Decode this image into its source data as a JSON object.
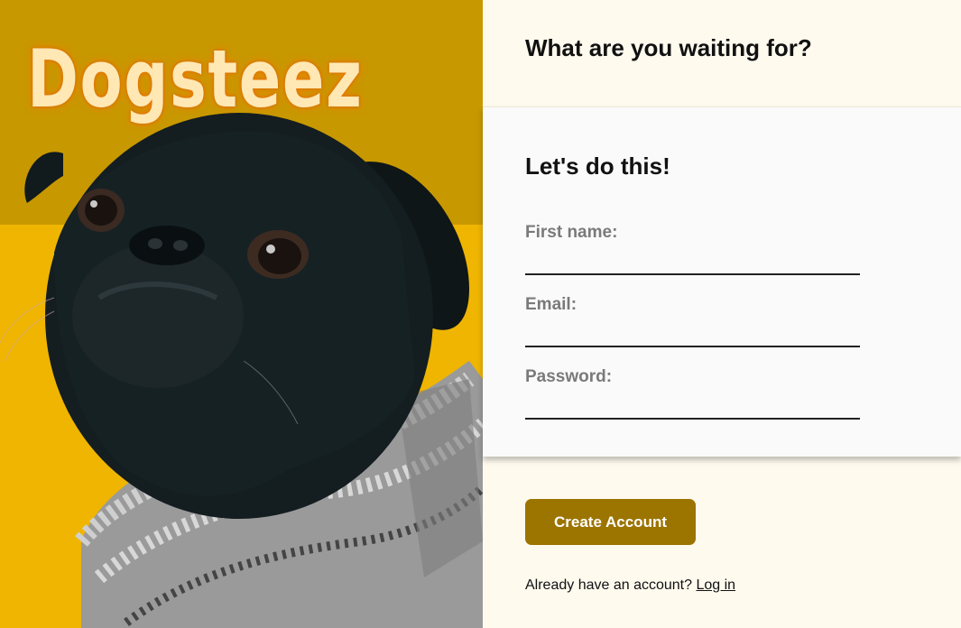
{
  "brand": {
    "name": "Dogsteez"
  },
  "hero": {
    "image_subject": "pug-in-knit-sweater"
  },
  "header": {
    "title": "What are you waiting for?"
  },
  "form": {
    "title": "Let's do this!",
    "fields": [
      {
        "label": "First name:",
        "value": "",
        "placeholder": ""
      },
      {
        "label": "Email:",
        "value": "",
        "placeholder": ""
      },
      {
        "label": "Password:",
        "value": "",
        "placeholder": ""
      }
    ],
    "submit_label": "Create Account"
  },
  "footer": {
    "prompt": "Already have an account?",
    "login_label": "Log in"
  },
  "colors": {
    "hero_top": "#c89800",
    "hero_bottom": "#efb500",
    "panel_bg": "#fefaee",
    "card_bg": "#fafafa",
    "button_bg": "#9c7400",
    "brand_text": "#ffe8b4"
  }
}
